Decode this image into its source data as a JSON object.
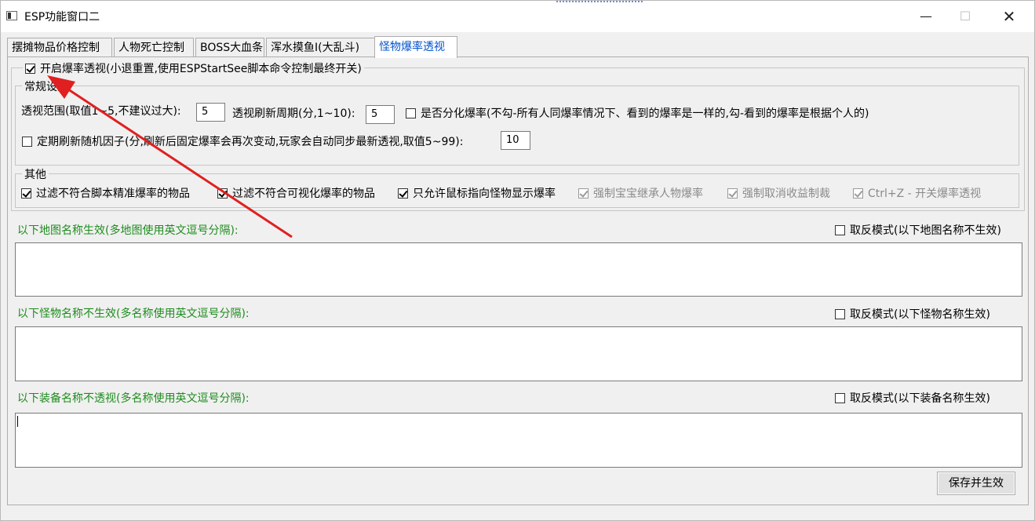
{
  "window": {
    "title": "ESP功能窗口二"
  },
  "tabs": [
    {
      "label": "摆摊物品价格控制"
    },
    {
      "label": "人物死亡控制"
    },
    {
      "label": "BOSS大血条"
    },
    {
      "label": "浑水摸鱼I(大乱斗)"
    },
    {
      "label": "怪物爆率透视"
    }
  ],
  "main": {
    "enable_label": "开启爆率透视(小退重置,使用ESPStartSee脚本命令控制最终开关)",
    "enable_checked": true,
    "general": {
      "title": "常规设置",
      "range_label": "透视范围(取值1~5,不建议过大):",
      "range_value": "5",
      "period_label": "透视刷新周期(分,1~10):",
      "period_value": "5",
      "split_label": "是否分化爆率(不勾-所有人同爆率情况下、看到的爆率是一样的,勾-看到的爆率是根据个人的)",
      "refresh_label": "定期刷新随机因子(分,刷新后固定爆率会再次变动,玩家会自动同步最新透视,取值5~99):",
      "refresh_value": "10"
    },
    "other": {
      "title": "其他",
      "options": [
        {
          "label": "过滤不符合脚本精准爆率的物品",
          "checked": true,
          "enabled": true
        },
        {
          "label": "过滤不符合可视化爆率的物品",
          "checked": true,
          "enabled": true
        },
        {
          "label": "只允许鼠标指向怪物显示爆率",
          "checked": true,
          "enabled": true
        },
        {
          "label": "强制宝宝继承人物爆率",
          "checked": true,
          "enabled": false
        },
        {
          "label": "强制取消收益制裁",
          "checked": true,
          "enabled": false
        },
        {
          "label": "Ctrl+Z - 开关爆率透视",
          "checked": true,
          "enabled": false
        }
      ]
    },
    "map_section": {
      "label": "以下地图名称生效(多地图使用英文逗号分隔):",
      "invert": "取反模式(以下地图名称不生效)",
      "value": ""
    },
    "monster_section": {
      "label": "以下怪物名称不生效(多名称使用英文逗号分隔):",
      "invert": "取反模式(以下怪物名称生效)",
      "value": ""
    },
    "equip_section": {
      "label": "以下装备名称不透视(多名称使用英文逗号分隔):",
      "invert": "取反模式(以下装备名称生效)",
      "value": ""
    },
    "save_label": "保存并生效"
  },
  "colors": {
    "active_tab": "#0052cc",
    "section_label": "#1e8c1e",
    "arrow": "#e02020"
  },
  "icons": {
    "close": "close-icon",
    "minimize": "minimize-icon",
    "maximize": "maximize-icon",
    "app": "app-window-icon"
  }
}
